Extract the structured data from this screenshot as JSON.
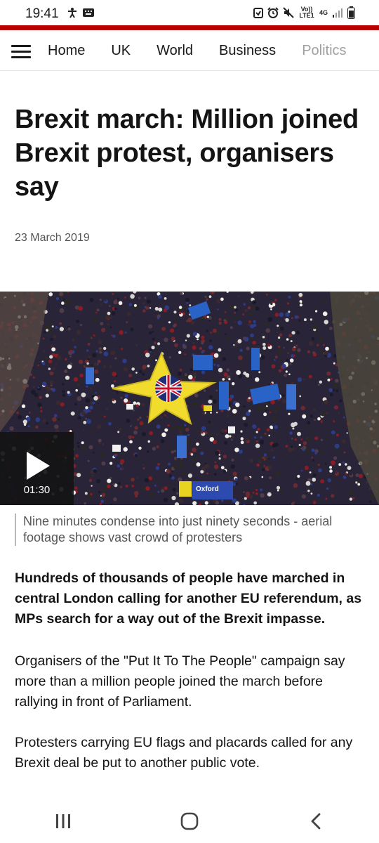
{
  "status": {
    "time": "19:41",
    "left_icons": [
      "accessibility-icon",
      "keyboard-icon"
    ],
    "right_icons": [
      "alarm-icon",
      "clock-icon",
      "mute-icon",
      "volte-indicator",
      "network-4g-indicator",
      "signal-icon",
      "battery-icon"
    ],
    "volte_text": "Vo)) LTE1",
    "network_text": "4G"
  },
  "colors": {
    "accent": "#b80000",
    "text": "#141414",
    "secondary_text": "#545658"
  },
  "nav": {
    "menu_icon": "hamburger-menu-icon",
    "links": [
      "Home",
      "UK",
      "World",
      "Business",
      "Politics"
    ]
  },
  "article": {
    "headline": "Brexit march: Million joined Brexit protest, organisers say",
    "date": "23 March 2019",
    "video": {
      "play_icon": "play-icon",
      "duration": "01:30",
      "placard_text": "Oxford"
    },
    "caption": "Nine minutes condense into just ninety seconds - aerial footage shows vast crowd of protesters",
    "intro": "Hundreds of thousands of people have marched in central London calling for another EU referendum, as MPs search for a way out of the Brexit impasse.",
    "paragraphs": [
      "Organisers of the \"Put It To The People\" campaign say more than a million people joined the march before rallying in front of Parliament.",
      "Protesters carrying EU flags and placards called for any Brexit deal be put to another public vote."
    ]
  },
  "system_nav": {
    "buttons": [
      "recent-apps-icon",
      "home-icon",
      "back-icon"
    ]
  }
}
